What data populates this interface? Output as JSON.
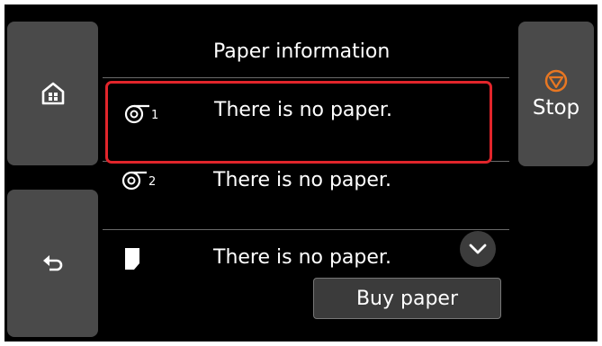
{
  "header": {
    "title": "Paper information"
  },
  "nav": {
    "home_icon": "home-icon",
    "back_icon": "back-arrow-icon"
  },
  "stop": {
    "label": "Stop",
    "icon": "stop-icon",
    "accent": "#e87722"
  },
  "paper_sources": [
    {
      "source": "roll-1",
      "icon": "roll-paper-1-icon",
      "status": "There is no paper.",
      "selected": true
    },
    {
      "source": "roll-2",
      "icon": "roll-paper-2-icon",
      "status": "There is no paper."
    },
    {
      "source": "sheet",
      "icon": "cut-sheet-icon",
      "status": "There is no paper."
    }
  ],
  "actions": {
    "buy_paper_label": "Buy paper",
    "scroll_icon": "chevron-down-icon"
  },
  "colors": {
    "highlight": "#e1252b",
    "background": "#000000",
    "button": "#4a4a4a"
  }
}
